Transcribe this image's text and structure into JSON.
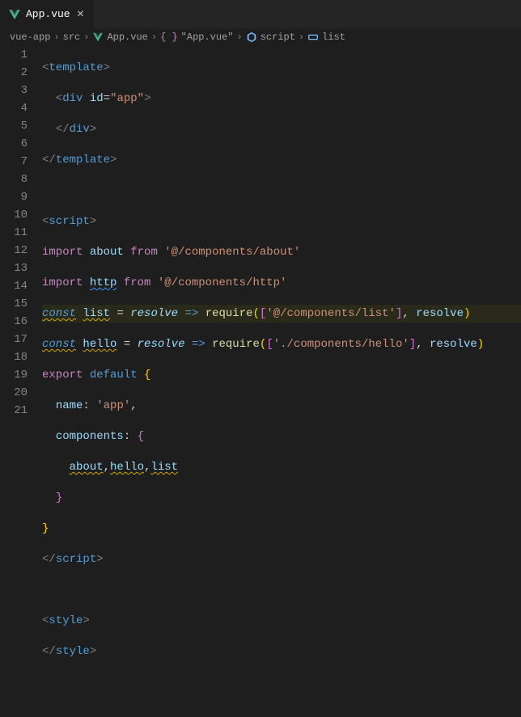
{
  "tab": {
    "label": "App.vue"
  },
  "breadcrumbs": {
    "items": [
      "vue-app",
      "src",
      "App.vue",
      "\"App.vue\"",
      "script",
      "list"
    ]
  },
  "lines": [
    "1",
    "2",
    "3",
    "4",
    "5",
    "6",
    "7",
    "8",
    "9",
    "10",
    "11",
    "12",
    "13",
    "14",
    "15",
    "16",
    "17",
    "18",
    "19",
    "20",
    "21"
  ],
  "code": {
    "l1": {
      "template": "template"
    },
    "l2": {
      "div": "div",
      "id": "id",
      "eq": "=",
      "val": "\"app\""
    },
    "l3": {
      "div": "div"
    },
    "l4": {
      "template": "template"
    },
    "l6": {
      "script": "script"
    },
    "l7": {
      "import": "import",
      "about": "about",
      "from": "from",
      "path": "'@/components/about'"
    },
    "l8": {
      "import": "import",
      "http": "http",
      "from": "from",
      "path": "'@/components/http'"
    },
    "l9": {
      "const": "const",
      "list": "list",
      "eq": "=",
      "resolve": "resolve",
      "arrow": "=>",
      "require": "require",
      "path": "'@/components/list'",
      "resolve2": "resolve"
    },
    "l10": {
      "const": "const",
      "hello": "hello",
      "eq": "=",
      "resolve": "resolve",
      "arrow": "=>",
      "require": "require",
      "path": "'./components/hello'",
      "resolve2": "resolve"
    },
    "l11": {
      "export": "export",
      "default": "default"
    },
    "l12": {
      "name": "name",
      "val": "'app'"
    },
    "l13": {
      "components": "components"
    },
    "l14": {
      "about": "about",
      "hello": "hello",
      "list": "list"
    },
    "l17": {
      "script": "script"
    },
    "l19": {
      "style": "style"
    },
    "l20": {
      "style": "style"
    }
  }
}
